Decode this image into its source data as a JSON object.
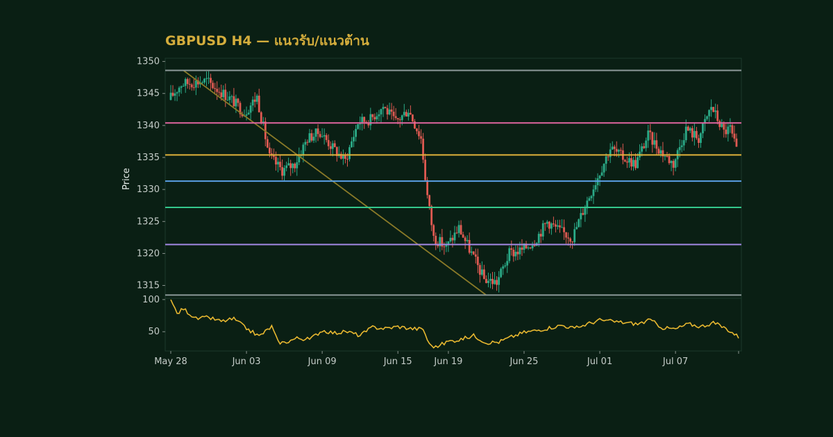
{
  "chart_data": {
    "type": "candlestick",
    "title": "GBPUSD H4 — แนวรับ/แนวต้าน",
    "ylabel": "Price",
    "ylim": [
      1313,
      1350.5
    ],
    "yticks": [
      1315,
      1320,
      1325,
      1330,
      1335,
      1340,
      1345,
      1350
    ],
    "x_range": [
      "2025-05-28",
      "2025-07-12"
    ],
    "xticks": [
      {
        "date": "2025-05-28",
        "label": "May 28"
      },
      {
        "date": "2025-06-03",
        "label": "Jun 03"
      },
      {
        "date": "2025-06-09",
        "label": "Jun 09"
      },
      {
        "date": "2025-06-15",
        "label": "Jun 15"
      },
      {
        "date": "2025-06-19",
        "label": "Jun 19"
      },
      {
        "date": "2025-06-25",
        "label": "Jun 25"
      },
      {
        "date": "2025-07-01",
        "label": "Jul 01"
      },
      {
        "date": "2025-07-07",
        "label": "Jul 07"
      }
    ],
    "levels": [
      {
        "value": 1348.6,
        "color": "#8d9a9a"
      },
      {
        "value": 1340.4,
        "color": "#e066a0"
      },
      {
        "value": 1335.4,
        "color": "#e0b23a"
      },
      {
        "value": 1331.3,
        "color": "#5aa0e6"
      },
      {
        "value": 1327.2,
        "color": "#34c88c"
      },
      {
        "value": 1321.4,
        "color": "#a58ae6"
      },
      {
        "value": 1313.5,
        "color": "#8d9a9a"
      }
    ],
    "trendline": {
      "start": {
        "date": "2025-05-29",
        "value": 1348.6
      },
      "end": {
        "date": "2025-06-22",
        "value": 1313.5
      },
      "color": "#8a7a28"
    },
    "colors": {
      "up": "#2bab88",
      "down": "#e05a52"
    },
    "price_anchors": [
      [
        "2025-05-28",
        1344.0
      ],
      [
        "2025-05-29",
        1346.5
      ],
      [
        "2025-05-31",
        1347.0
      ],
      [
        "2025-06-02",
        1344.0
      ],
      [
        "2025-06-03",
        1342.0
      ],
      [
        "2025-06-04",
        1344.5
      ],
      [
        "2025-06-05",
        1335.0
      ],
      [
        "2025-06-06",
        1333.0
      ],
      [
        "2025-06-07",
        1334.0
      ],
      [
        "2025-06-08",
        1338.0
      ],
      [
        "2025-06-09",
        1339.0
      ],
      [
        "2025-06-10",
        1336.5
      ],
      [
        "2025-06-11",
        1334.5
      ],
      [
        "2025-06-12",
        1340.5
      ],
      [
        "2025-06-13",
        1341.0
      ],
      [
        "2025-06-14",
        1343.0
      ],
      [
        "2025-06-15",
        1340.5
      ],
      [
        "2025-06-16",
        1342.5
      ],
      [
        "2025-06-17",
        1338.0
      ],
      [
        "2025-06-17T12:00",
        1329.0
      ],
      [
        "2025-06-18",
        1322.5
      ],
      [
        "2025-06-19",
        1321.0
      ],
      [
        "2025-06-20",
        1324.0
      ],
      [
        "2025-06-21",
        1320.0
      ],
      [
        "2025-06-22",
        1316.0
      ],
      [
        "2025-06-23",
        1315.5
      ],
      [
        "2025-06-24",
        1320.0
      ],
      [
        "2025-06-25",
        1320.5
      ],
      [
        "2025-06-26",
        1322.0
      ],
      [
        "2025-06-27",
        1325.0
      ],
      [
        "2025-06-28",
        1323.5
      ],
      [
        "2025-06-29",
        1322.5
      ],
      [
        "2025-06-30",
        1327.5
      ],
      [
        "2025-07-01",
        1332.0
      ],
      [
        "2025-07-02",
        1336.5
      ],
      [
        "2025-07-03",
        1335.0
      ],
      [
        "2025-07-04",
        1334.0
      ],
      [
        "2025-07-05",
        1338.5
      ],
      [
        "2025-07-06",
        1336.0
      ],
      [
        "2025-07-07",
        1334.0
      ],
      [
        "2025-07-08",
        1339.5
      ],
      [
        "2025-07-09",
        1338.0
      ],
      [
        "2025-07-10",
        1343.0
      ],
      [
        "2025-07-11",
        1339.0
      ],
      [
        "2025-07-11T12:00",
        1339.5
      ],
      [
        "2025-07-12",
        1336.0
      ]
    ],
    "oscillator": {
      "ylim": [
        20,
        102
      ],
      "yticks": [
        50,
        100
      ],
      "color": "#e8b830",
      "anchors": [
        [
          "2025-05-28",
          100
        ],
        [
          "2025-05-28T12:00",
          78
        ],
        [
          "2025-05-29",
          86
        ],
        [
          "2025-05-30",
          70
        ],
        [
          "2025-05-31",
          72
        ],
        [
          "2025-06-01",
          66
        ],
        [
          "2025-06-02",
          70
        ],
        [
          "2025-06-03",
          55
        ],
        [
          "2025-06-04",
          43
        ],
        [
          "2025-06-05",
          58
        ],
        [
          "2025-06-05T12:00",
          34
        ],
        [
          "2025-06-06",
          33
        ],
        [
          "2025-06-07",
          40
        ],
        [
          "2025-06-08",
          38
        ],
        [
          "2025-06-09",
          52
        ],
        [
          "2025-06-10",
          48
        ],
        [
          "2025-06-11",
          50
        ],
        [
          "2025-06-12",
          44
        ],
        [
          "2025-06-13",
          57
        ],
        [
          "2025-06-14",
          55
        ],
        [
          "2025-06-15",
          58
        ],
        [
          "2025-06-16",
          55
        ],
        [
          "2025-06-17",
          54
        ],
        [
          "2025-06-17T12:00",
          30
        ],
        [
          "2025-06-18",
          26
        ],
        [
          "2025-06-19",
          35
        ],
        [
          "2025-06-20",
          38
        ],
        [
          "2025-06-21",
          44
        ],
        [
          "2025-06-22",
          33
        ],
        [
          "2025-06-23",
          34
        ],
        [
          "2025-06-24",
          42
        ],
        [
          "2025-06-25",
          49
        ],
        [
          "2025-06-26",
          52
        ],
        [
          "2025-06-27",
          56
        ],
        [
          "2025-06-28",
          60
        ],
        [
          "2025-06-29",
          55
        ],
        [
          "2025-06-30",
          62
        ],
        [
          "2025-07-01",
          68
        ],
        [
          "2025-07-02",
          66
        ],
        [
          "2025-07-03",
          64
        ],
        [
          "2025-07-04",
          62
        ],
        [
          "2025-07-05",
          68
        ],
        [
          "2025-07-06",
          56
        ],
        [
          "2025-07-07",
          54
        ],
        [
          "2025-07-08",
          62
        ],
        [
          "2025-07-09",
          58
        ],
        [
          "2025-07-10",
          64
        ],
        [
          "2025-07-11",
          55
        ],
        [
          "2025-07-12",
          42
        ]
      ]
    }
  }
}
